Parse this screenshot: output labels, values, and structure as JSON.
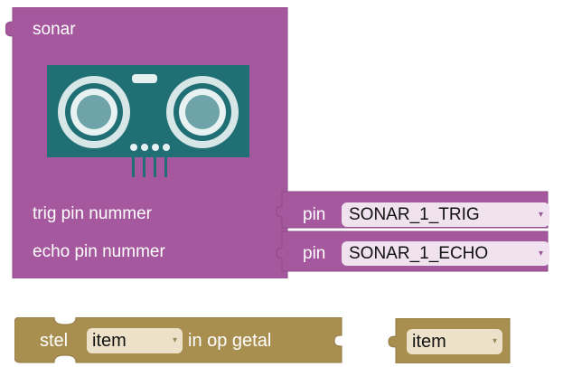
{
  "sonar_block": {
    "title": "sonar",
    "trig_label": "trig pin nummer",
    "echo_label": "echo pin nummer",
    "trig_pin": {
      "prefix": "pin",
      "value": "SONAR_1_TRIG"
    },
    "echo_pin": {
      "prefix": "pin",
      "value": "SONAR_1_ECHO"
    },
    "color": "#a5589e",
    "sensor_color": "#1f6f74"
  },
  "set_variable_block": {
    "prefix": "stel",
    "variable": "item",
    "suffix": "in op getal",
    "color": "#a88e4f"
  },
  "get_variable_block": {
    "variable": "item",
    "color": "#a88e4f"
  },
  "dropdown_caret": "▾"
}
